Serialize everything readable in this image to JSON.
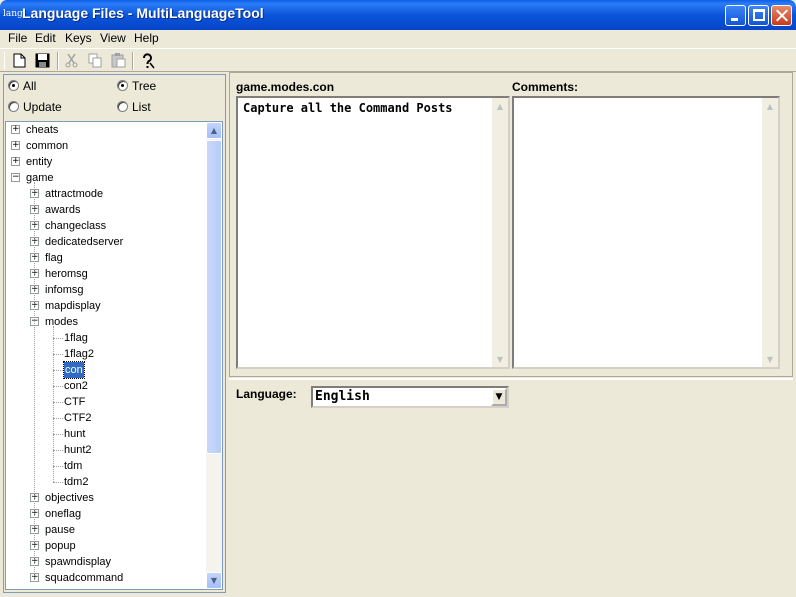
{
  "window": {
    "icon_text": "lang",
    "title": "Language Files - MultiLanguageTool"
  },
  "menu": [
    "File",
    "Edit",
    "Keys",
    "View",
    "Help"
  ],
  "toolbar": {
    "icons": [
      "new-document-icon",
      "save-icon",
      "cut-icon",
      "copy-icon",
      "paste-icon",
      "help-icon"
    ]
  },
  "filters": {
    "all": "All",
    "update": "Update",
    "tree": "Tree",
    "list": "List",
    "selected_scope": "All",
    "selected_view": "Tree"
  },
  "tree": {
    "root_items": [
      "cheats",
      "common",
      "entity",
      "game"
    ],
    "game_children": [
      "attractmode",
      "awards",
      "changeclass",
      "dedicatedserver",
      "flag",
      "heromsg",
      "infomsg",
      "mapdisplay",
      "modes",
      "objectives",
      "oneflag",
      "pause",
      "popup",
      "spawndisplay",
      "squadcommand"
    ],
    "modes_children": [
      "1flag",
      "1flag2",
      "con",
      "con2",
      "CTF",
      "CTF2",
      "hunt",
      "hunt2",
      "tdm",
      "tdm2"
    ],
    "selected": "con"
  },
  "editor": {
    "key_path": "game.modes.con",
    "value_text": "Capture all the Command Posts",
    "comments_label": "Comments:",
    "comments_text": ""
  },
  "language": {
    "label": "Language:",
    "selected": "English"
  },
  "colors": {
    "titlebar": "#0a5fe8",
    "selection": "#316ac5",
    "face": "#ece9d8"
  }
}
